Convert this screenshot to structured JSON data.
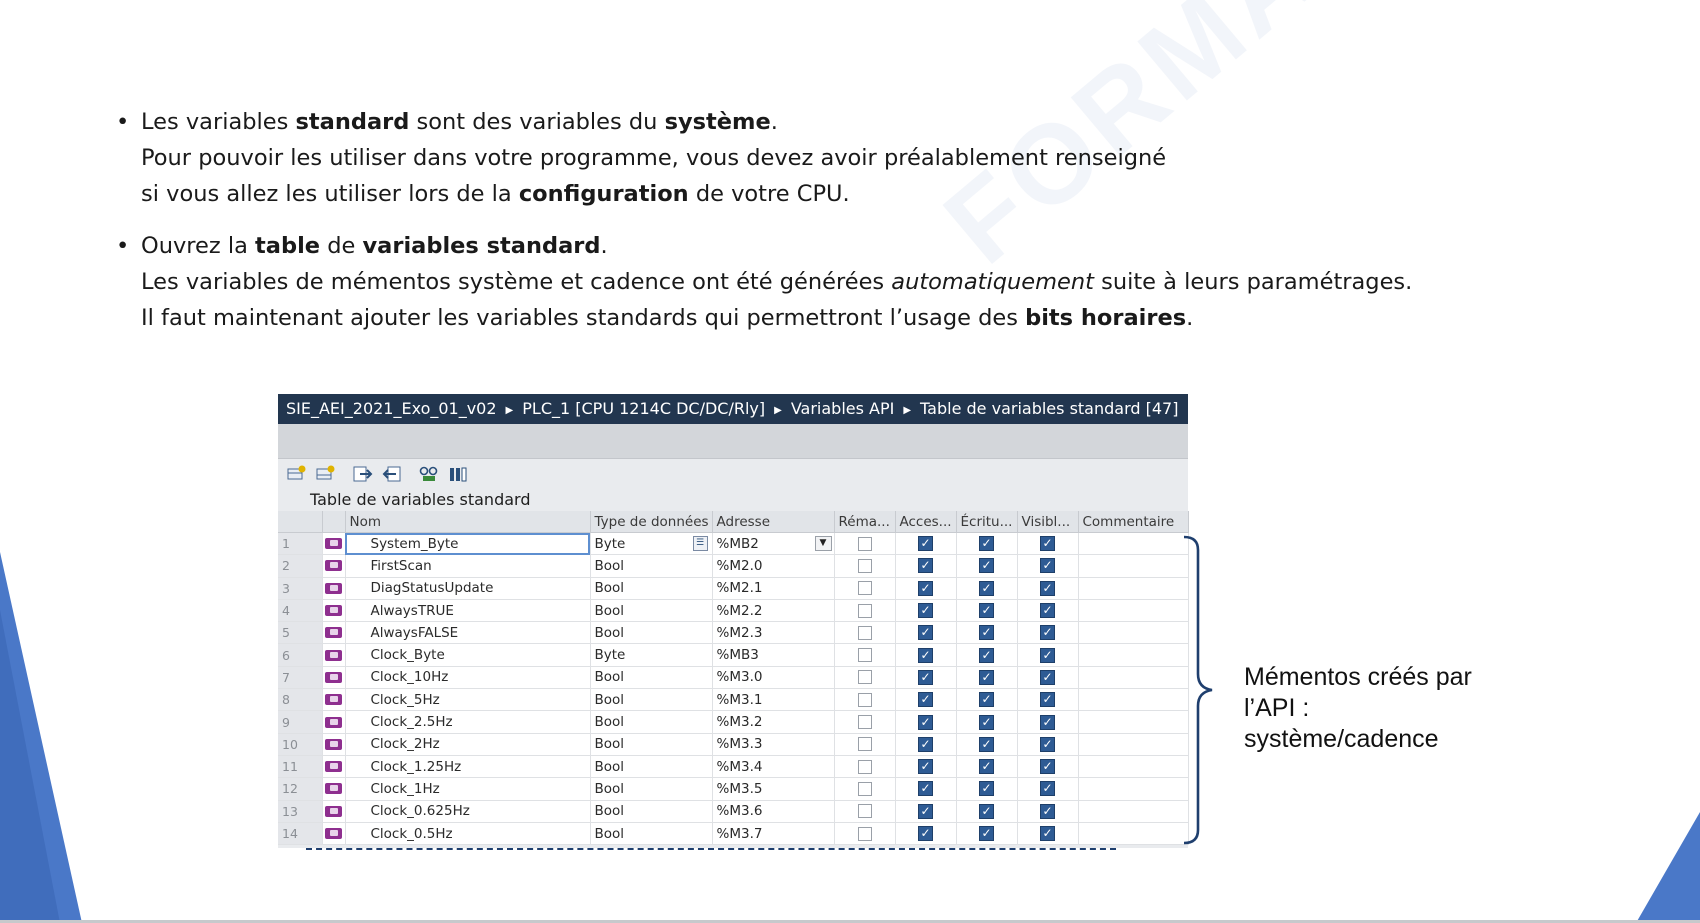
{
  "slide": {
    "bullet1": {
      "line1": {
        "t1": "Les variables ",
        "b1": "standard",
        "t2": " sont des variables du ",
        "b2": "système",
        "t3": "."
      },
      "line2": "Pour pouvoir les utiliser dans votre programme, vous devez avoir préalablement renseigné",
      "line3": {
        "t1": "si vous allez les utiliser lors de la ",
        "b1": "configuration",
        "t2": " de votre CPU."
      }
    },
    "bullet2": {
      "line1": {
        "t1": "Ouvrez la ",
        "b1": "table",
        "t2": " de ",
        "b2": "variables standard",
        "t3": "."
      },
      "line2": {
        "t1": "Les variables de mémentos système et cadence ont été générées ",
        "i1": "automatiquement",
        "t2": " suite à leurs paramétrages."
      },
      "line3": {
        "t1": "Il faut maintenant ajouter les variables standards qui permettront l’usage des ",
        "b1": "bits horaires",
        "t2": "."
      }
    },
    "annotation": [
      "Mémentos créés par",
      "l’API :",
      "système/cadence"
    ]
  },
  "screenshot": {
    "breadcrumb": [
      "SIE_AEI_2021_Exo_01_v02",
      "PLC_1 [CPU 1214C DC/DC/Rly]",
      "Variables API",
      "Table de variables standard [47]"
    ],
    "table_title": "Table de variables standard",
    "columns": [
      "Nom",
      "Type de données",
      "Adresse",
      "Réma...",
      "Acces...",
      "Écritu...",
      "Visibl...",
      "Commentaire"
    ],
    "rows": [
      {
        "num": "1",
        "name": "System_Byte",
        "type": "Byte",
        "address": "%MB2"
      },
      {
        "num": "2",
        "name": "FirstScan",
        "type": "Bool",
        "address": "%M2.0"
      },
      {
        "num": "3",
        "name": "DiagStatusUpdate",
        "type": "Bool",
        "address": "%M2.1"
      },
      {
        "num": "4",
        "name": "AlwaysTRUE",
        "type": "Bool",
        "address": "%M2.2"
      },
      {
        "num": "5",
        "name": "AlwaysFALSE",
        "type": "Bool",
        "address": "%M2.3"
      },
      {
        "num": "6",
        "name": "Clock_Byte",
        "type": "Byte",
        "address": "%MB3"
      },
      {
        "num": "7",
        "name": "Clock_10Hz",
        "type": "Bool",
        "address": "%M3.0"
      },
      {
        "num": "8",
        "name": "Clock_5Hz",
        "type": "Bool",
        "address": "%M3.1"
      },
      {
        "num": "9",
        "name": "Clock_2.5Hz",
        "type": "Bool",
        "address": "%M3.2"
      },
      {
        "num": "10",
        "name": "Clock_2Hz",
        "type": "Bool",
        "address": "%M3.3"
      },
      {
        "num": "11",
        "name": "Clock_1.25Hz",
        "type": "Bool",
        "address": "%M3.4"
      },
      {
        "num": "12",
        "name": "Clock_1Hz",
        "type": "Bool",
        "address": "%M3.5"
      },
      {
        "num": "13",
        "name": "Clock_0.625Hz",
        "type": "Bool",
        "address": "%M3.6"
      },
      {
        "num": "14",
        "name": "Clock_0.5Hz",
        "type": "Bool",
        "address": "%M3.7"
      }
    ],
    "checkbox_states": {
      "retain": false,
      "accessible": true,
      "writable": true,
      "visible": true
    }
  },
  "colors": {
    "accent_blue": "#4472c4",
    "header_dark": "#22364f",
    "brace": "#1f3f6e",
    "checkbox": "#2e5b94"
  }
}
